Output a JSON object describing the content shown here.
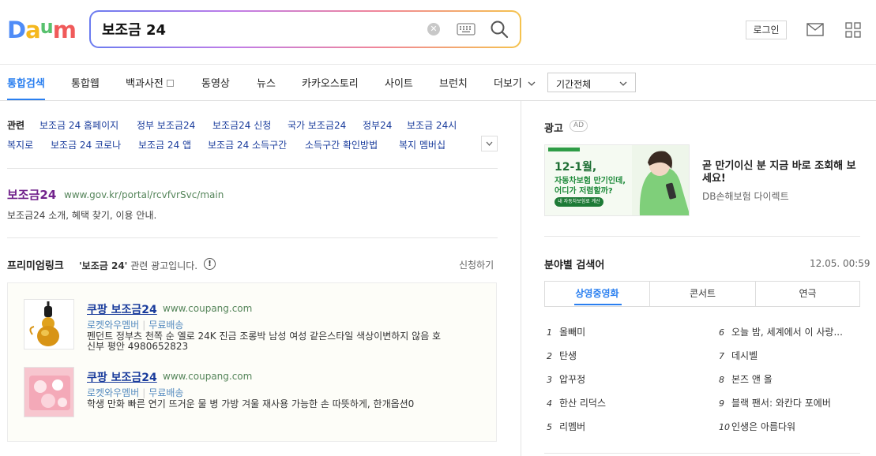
{
  "header": {
    "logo_text": "Daum",
    "search": {
      "value": "보조금 24",
      "placeholder": ""
    },
    "login_label": "로그인"
  },
  "tabs": [
    {
      "label": "통합검색",
      "active": true
    },
    {
      "label": "통합웹"
    },
    {
      "label": "백과사전"
    },
    {
      "label": "동영상"
    },
    {
      "label": "뉴스"
    },
    {
      "label": "카카오스토리"
    },
    {
      "label": "사이트"
    },
    {
      "label": "브런치"
    },
    {
      "label": "더보기"
    }
  ],
  "period_select": {
    "selected": "기간전체"
  },
  "related": {
    "label": "관련",
    "items": [
      "보조금 24 홈페이지",
      "정부 보조금24",
      "보조금24 신청",
      "국가 보조금24",
      "정부24",
      "보조금 24시",
      "복지로",
      "보조금 24 코로나",
      "보조금 24 앱",
      "보조금 24 소득구간",
      "소득구간 확인방법",
      "복지 멤버십"
    ]
  },
  "result": {
    "title": "보조금24",
    "url": "www.gov.kr/portal/rcvfvrSvc/main",
    "description": "보조금24 소개, 혜택 찾기, 이용 안내."
  },
  "premium": {
    "title": "프리미엄링크",
    "query_quote": "'보조금 24'",
    "description_suffix": "관련 광고입니다.",
    "info_glyph": "!",
    "apply_label": "신청하기",
    "ads": [
      {
        "title": "쿠팡 보조금24",
        "url": "www.coupang.com",
        "tags": [
          "로켓와우멤버",
          "무료배송"
        ],
        "description": "펜던트 정부츠 천쪽 순 엘로 24K 진금 조롱박 남성 여성 같은스타일 색상이변하지 않음 호신부 평안 4980652823"
      },
      {
        "title": "쿠팡 보조금24",
        "url": "www.coupang.com",
        "tags": [
          "로켓와우멤버",
          "무료배송"
        ],
        "description": "학생 만화 빠른 연기 뜨거운 물 병 가방 겨울 재사용 가능한 손 따뜻하게, 한개옵션0"
      }
    ]
  },
  "sidebar_ad": {
    "title": "광고",
    "badge": "AD",
    "banner_text_line1": "12-1월,",
    "banner_text_line2": "자동차보험 만기인데,",
    "banner_text_line3": "어디가 저렴할까?",
    "banner_button": "내 자동차보험료 계산",
    "headline": "곧 만기이신 분 지금 바로 조회해 보세요!",
    "advertiser": "DB손해보험 다이렉트"
  },
  "keywords": {
    "title": "분야별 검색어",
    "time": "12.05. 00:59",
    "tabs": [
      {
        "label": "상영중영화",
        "active": true
      },
      {
        "label": "콘서트"
      },
      {
        "label": "연극"
      }
    ],
    "items": [
      {
        "rank": "1",
        "text": "올빼미"
      },
      {
        "rank": "2",
        "text": "탄생"
      },
      {
        "rank": "3",
        "text": "압꾸정"
      },
      {
        "rank": "4",
        "text": "한산 리덕스"
      },
      {
        "rank": "5",
        "text": "리멤버"
      },
      {
        "rank": "6",
        "text": "오늘 밤, 세계에서 이 사랑..."
      },
      {
        "rank": "7",
        "text": "데시벨"
      },
      {
        "rank": "8",
        "text": "본즈 앤 올"
      },
      {
        "rank": "9",
        "text": "블랙 팬서: 와칸다 포에버"
      },
      {
        "rank": "10",
        "text": "인생은 아름다워"
      }
    ]
  },
  "colors": {
    "accent": "#2a7ff0",
    "link": "#1a3c9c",
    "url_green": "#55855a",
    "visited": "#72238c"
  }
}
